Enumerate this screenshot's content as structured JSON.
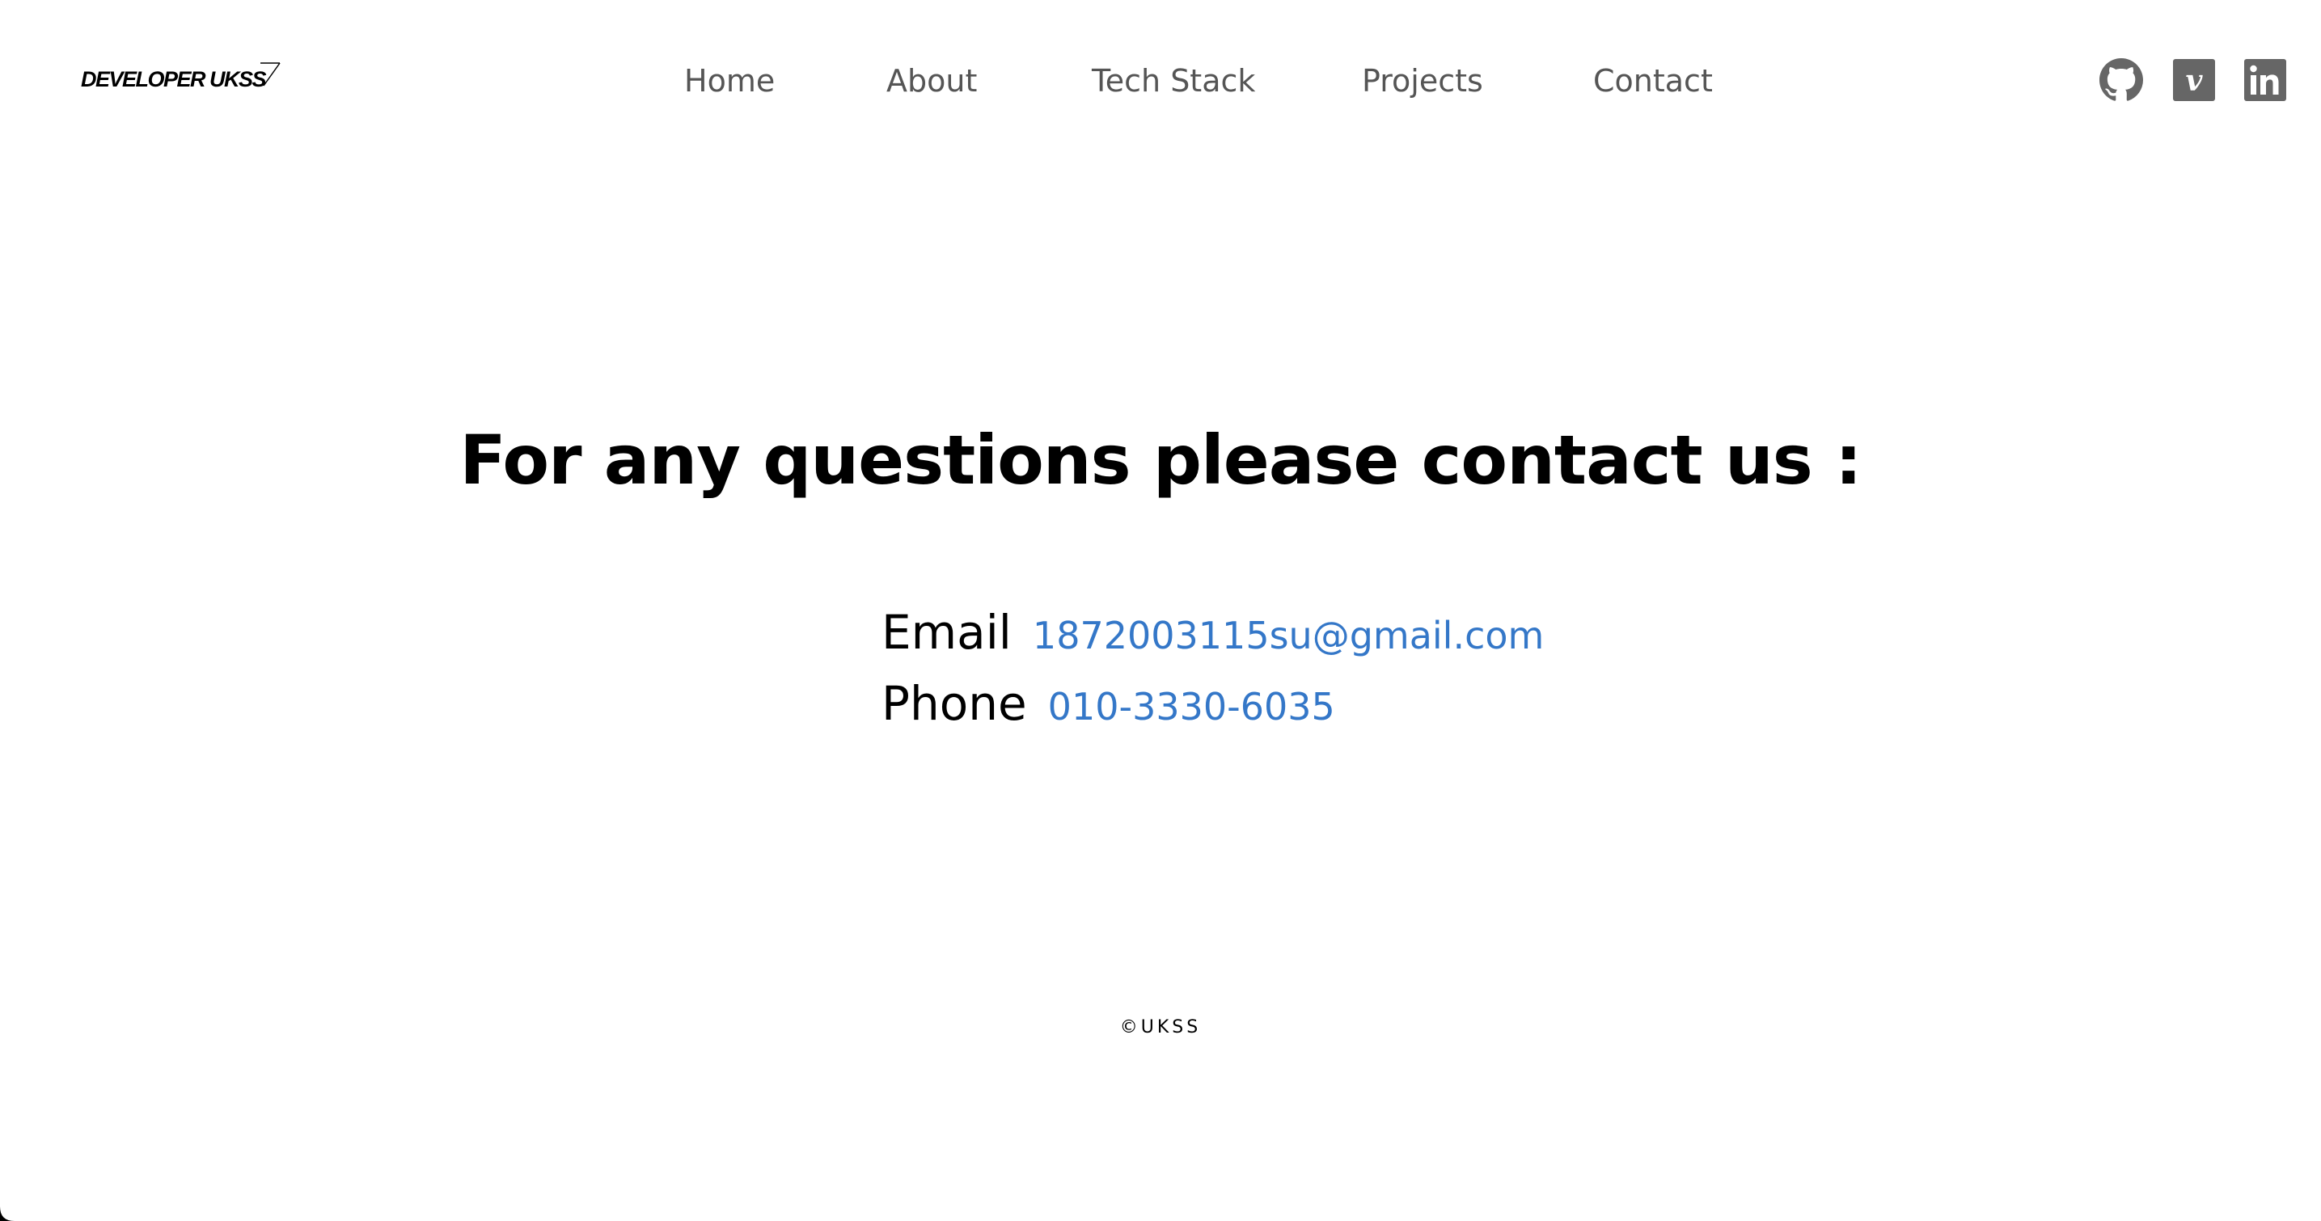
{
  "logo": {
    "text": "DEVELOPER UKSS"
  },
  "nav": {
    "items": [
      {
        "label": "Home"
      },
      {
        "label": "About"
      },
      {
        "label": "Tech Stack"
      },
      {
        "label": "Projects"
      },
      {
        "label": "Contact"
      }
    ]
  },
  "social": {
    "icons": [
      "github-icon",
      "vimeo-icon",
      "linkedin-icon"
    ],
    "icon_color": "#666666"
  },
  "main": {
    "headline": "For any questions please contact us :",
    "email": {
      "label": "Email",
      "value": "1872003115su@gmail.com"
    },
    "phone": {
      "label": "Phone",
      "value": "010-3330-6035"
    },
    "link_color": "#3477c8"
  },
  "footer": {
    "copyright": "©UKSS"
  }
}
